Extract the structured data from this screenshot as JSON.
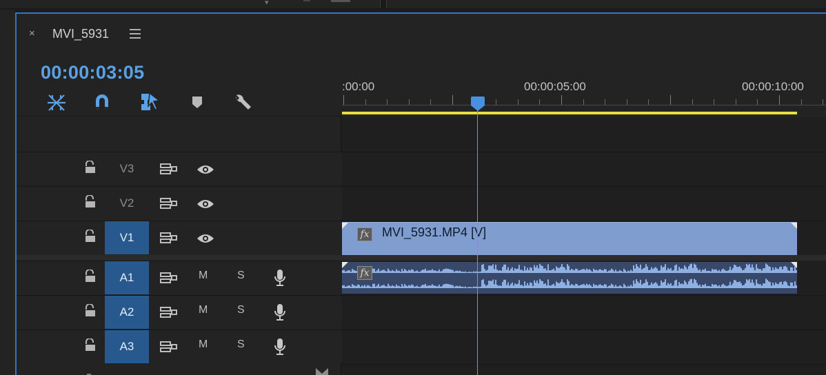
{
  "panel": {
    "tab_title": "MVI_5931",
    "close_glyph": "×",
    "timecode": "00:00:03:05"
  },
  "tools": [
    {
      "name": "insert-overwrite-icon",
      "color": "#5aa1e6"
    },
    {
      "name": "snap-magnet-icon",
      "color": "#5aa1e6"
    },
    {
      "name": "linked-selection-icon",
      "color": "#5aa1e6"
    },
    {
      "name": "add-marker-icon",
      "color": "#b8b8b8"
    },
    {
      "name": "timeline-settings-wrench-icon",
      "color": "#b8b8b8"
    }
  ],
  "ruler": {
    "labels": [
      ":00:00",
      "00:00:05:00",
      "00:00:10:00"
    ]
  },
  "tracks": {
    "video": [
      {
        "name": "V3",
        "active": false
      },
      {
        "name": "V2",
        "active": false
      },
      {
        "name": "V1",
        "active": true
      }
    ],
    "audio": [
      {
        "name": "A1",
        "active": true,
        "mute": "M",
        "solo": "S"
      },
      {
        "name": "A2",
        "active": true,
        "mute": "M",
        "solo": "S"
      },
      {
        "name": "A3",
        "active": true,
        "mute": "M",
        "solo": "S"
      }
    ]
  },
  "clips": {
    "video_clip_name": "MVI_5931.MP4 [V]",
    "fx_label": "fx"
  },
  "colors": {
    "accent": "#5aa1e6",
    "active_track": "#27598f",
    "video_clip": "#7f9ecf",
    "audio_clip": "#37486b",
    "work_area_bar": "#e6df40"
  }
}
